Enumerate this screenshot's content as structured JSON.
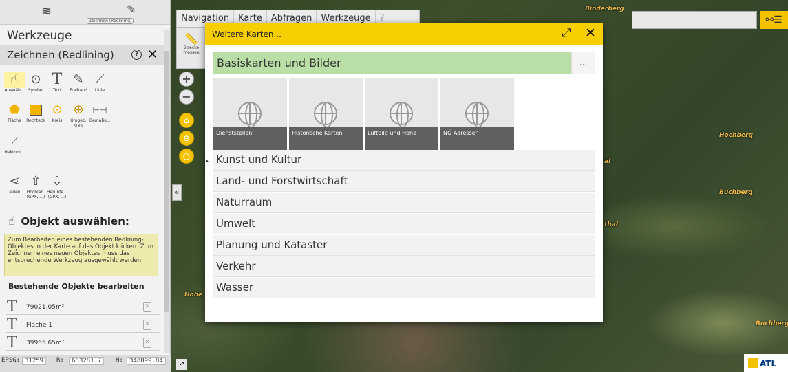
{
  "map": {
    "place_labels": [
      "Binderberg",
      "Hochberg",
      "Buchberg",
      "Buchberg",
      "Hohe",
      "thal",
      "al"
    ]
  },
  "left_panel": {
    "active_tab_label": "Zeichnen (Redlining)",
    "title": "Werkzeuge",
    "subtitle": "Zeichnen (Redlining)",
    "help_icon": "question-circle-icon",
    "tools_row1": [
      {
        "icon": "hand-pointer-icon",
        "label": "Auswäh..."
      },
      {
        "icon": "map-pin-icon",
        "label": "Symbol"
      },
      {
        "icon": "text-icon",
        "label": "Text"
      },
      {
        "icon": "freehand-pen-icon",
        "label": "Freihand"
      },
      {
        "icon": "polyline-icon",
        "label": "Linie"
      }
    ],
    "tools_row2": [
      {
        "icon": "polygon-icon",
        "label": "Fläche"
      },
      {
        "icon": "rectangle-icon",
        "label": "Rechteck"
      },
      {
        "icon": "circle-icon",
        "label": "Kreis"
      },
      {
        "icon": "buffer-icon",
        "label": "Umgeb. kreis"
      },
      {
        "icon": "dimension-icon",
        "label": "Bemaßu..."
      }
    ],
    "tools_row3": [
      {
        "icon": "hectometer-icon",
        "label": "Hektom..."
      }
    ],
    "tools_row4": [
      {
        "icon": "share-icon",
        "label": "Teilen"
      },
      {
        "icon": "upload-icon",
        "label": "Hochlad. (GPX, ...)"
      },
      {
        "icon": "download-icon",
        "label": "Herunte... (GPX, ...)"
      }
    ],
    "select_heading": "Objekt auswählen:",
    "info_text": "Zum Bearbeiten eines bestehenden Redlining-Objektes in der Karte auf das Objekt klicken. Zum Zeichnen eines neuen Objektes muss das entsprechende Werkzeug ausgewählt werden.",
    "existing_heading": "Bestehende Objekte bearbeiten",
    "objects": [
      "79021.05m²",
      "Fläche 1",
      "39965.65m²"
    ],
    "status": {
      "epsg_label": "EPSG:",
      "epsg": "31259",
      "r_label": "R:",
      "r": "683281.7",
      "h_label": "H:",
      "h": "348099.84"
    }
  },
  "menubar": {
    "items": [
      "Navigation",
      "Karte",
      "Abfragen",
      "Werkzeuge",
      "?"
    ],
    "strip_label": "Strecke messen"
  },
  "modal": {
    "title": "Weitere Karten...",
    "section_head": "Basiskarten und Bilder",
    "section_more": "...",
    "tiles": [
      "Dienststellen",
      "Historische Karten",
      "Luftbild und Höhe",
      "NÖ Adressen"
    ],
    "categories": [
      "Kunst und Kultur",
      "Land- und Forstwirtschaft",
      "Naturraum",
      "Umwelt",
      "Planung und Kataster",
      "Verkehr",
      "Wasser"
    ]
  },
  "logo": {
    "text": "ATL"
  },
  "colors": {
    "accent": "#f7cf00",
    "section_green": "#b9dfa6",
    "tile_caption": "#606060"
  }
}
